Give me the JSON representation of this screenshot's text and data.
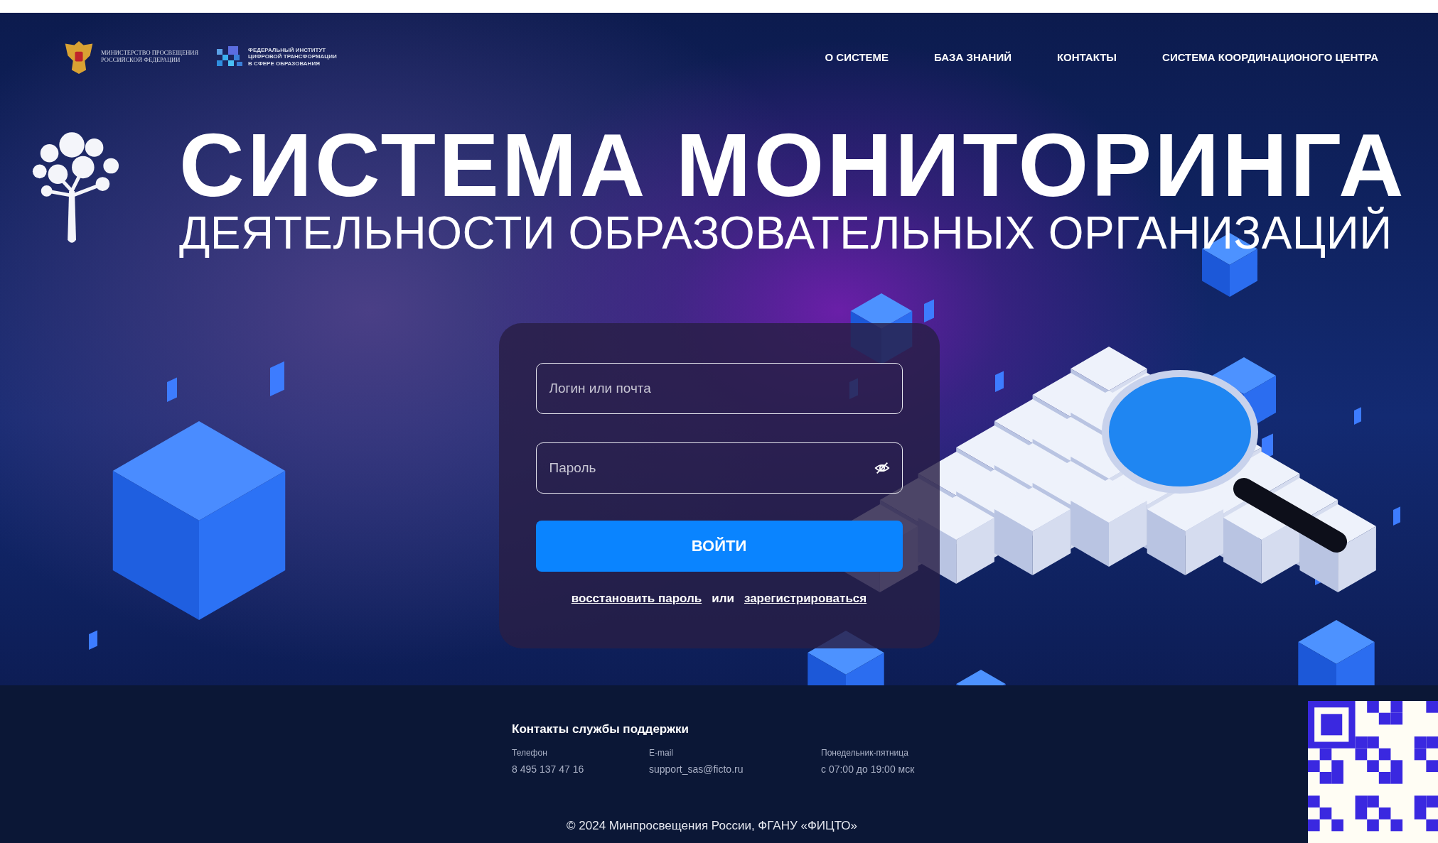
{
  "header": {
    "ministry_logo": [
      "МИНИСТЕРСТВО ПРОСВЕЩЕНИЯ",
      "РОССИЙСКОЙ ФЕДЕРАЦИИ"
    ],
    "institute_logo": [
      "ФЕДЕРАЛЬНЫЙ ИНСТИТУТ",
      "ЦИФРОВОЙ ТРАНСФОРМАЦИИ",
      "В СФЕРЕ ОБРАЗОВАНИЯ"
    ],
    "nav": [
      "О СИСТЕМЕ",
      "БАЗА ЗНАНИЙ",
      "КОНТАКТЫ",
      "СИСТЕМА КООРДИНАЦИОНОГО ЦЕНТРА"
    ]
  },
  "hero": {
    "title": "СИСТЕМА МОНИТОРИНГА",
    "subtitle": "ДЕЯТЕЛЬНОСТИ ОБРАЗОВАТЕЛЬНЫХ ОРГАНИЗАЦИЙ"
  },
  "login_form": {
    "login": {
      "placeholder": "Логин или почта"
    },
    "password": {
      "placeholder": "Пароль"
    },
    "submit": "ВОЙТИ",
    "restore_link": "восстановить пароль",
    "separator": "или",
    "register_link": "зарегистрироваться"
  },
  "footer": {
    "heading": "Контакты службы поддержки",
    "contacts": [
      {
        "label": "Телефон",
        "value": "8 495 137 47 16"
      },
      {
        "label": "E-mail",
        "value": "support_sas@ficto.ru"
      },
      {
        "label": "Понедельник-пятница",
        "value": "с 07:00 до 19:00 мск"
      }
    ],
    "copyright": "© 2024 Минпросвещения России, ФГАНУ «ФИЦТО»"
  }
}
